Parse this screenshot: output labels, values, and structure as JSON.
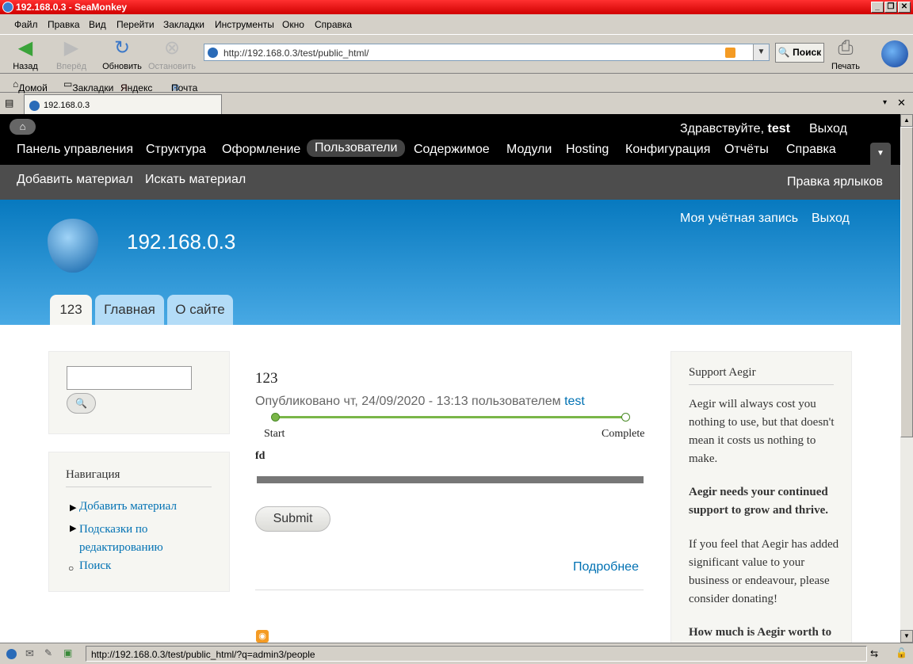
{
  "window": {
    "title": "192.168.0.3 - SeaMonkey",
    "min": "_",
    "max": "❐",
    "close": "✕"
  },
  "menu": [
    "Файл",
    "Правка",
    "Вид",
    "Перейти",
    "Закладки",
    "Инструменты",
    "Окно",
    "Справка"
  ],
  "nav": {
    "back": "Назад",
    "forward": "Вперёд",
    "reload": "Обновить",
    "stop": "Остановить",
    "search": "Поиск",
    "print": "Печать"
  },
  "url": "http://192.168.0.3/test/public_html/",
  "bookmarks": [
    "Домой",
    "Закладки",
    "Яндекс",
    "Почта"
  ],
  "tab": {
    "title": "192.168.0.3"
  },
  "drupal": {
    "greeting": "Здравствуйте,",
    "user": "test",
    "logout": "Выход",
    "menu": [
      "Панель управления",
      "Структура",
      "Оформление",
      "Пользователи",
      "Содержимое",
      "Модули",
      "Hosting",
      "Конфигурация",
      "Отчёты",
      "Справка"
    ],
    "shortcuts": [
      "Добавить материал",
      "Искать материал"
    ],
    "edit_shortcuts": "Правка ярлыков",
    "account_links": [
      "Моя учётная запись",
      "Выход"
    ],
    "site_name": "192.168.0.3",
    "primary_tabs": [
      "123",
      "Главная",
      "О сайте"
    ]
  },
  "sidebar": {
    "search_button": "🔍",
    "nav_title": "Навигация",
    "nav_items": [
      "Добавить материал",
      "Подсказки по редактированию",
      "Поиск"
    ]
  },
  "node": {
    "title": "123",
    "submitted": "Опубликовано чт, 24/09/2020 - 13:13 пользователем",
    "author": "test",
    "progress_start": "Start",
    "progress_end": "Complete",
    "field": "fd",
    "submit": "Submit",
    "more": "Подробнее"
  },
  "aegir": {
    "title": "Support Aegir",
    "p1": "Aegir will always cost you nothing to use, but that doesn't mean it costs us nothing to make.",
    "p2": "Aegir needs your continued support to grow and thrive.",
    "p3": "If you feel that Aegir has added significant value to your business or endeavour, please consider donating!",
    "p4": "How much is Aegir worth to"
  },
  "status_url": "http://192.168.0.3/test/public_html/?q=admin3/people"
}
